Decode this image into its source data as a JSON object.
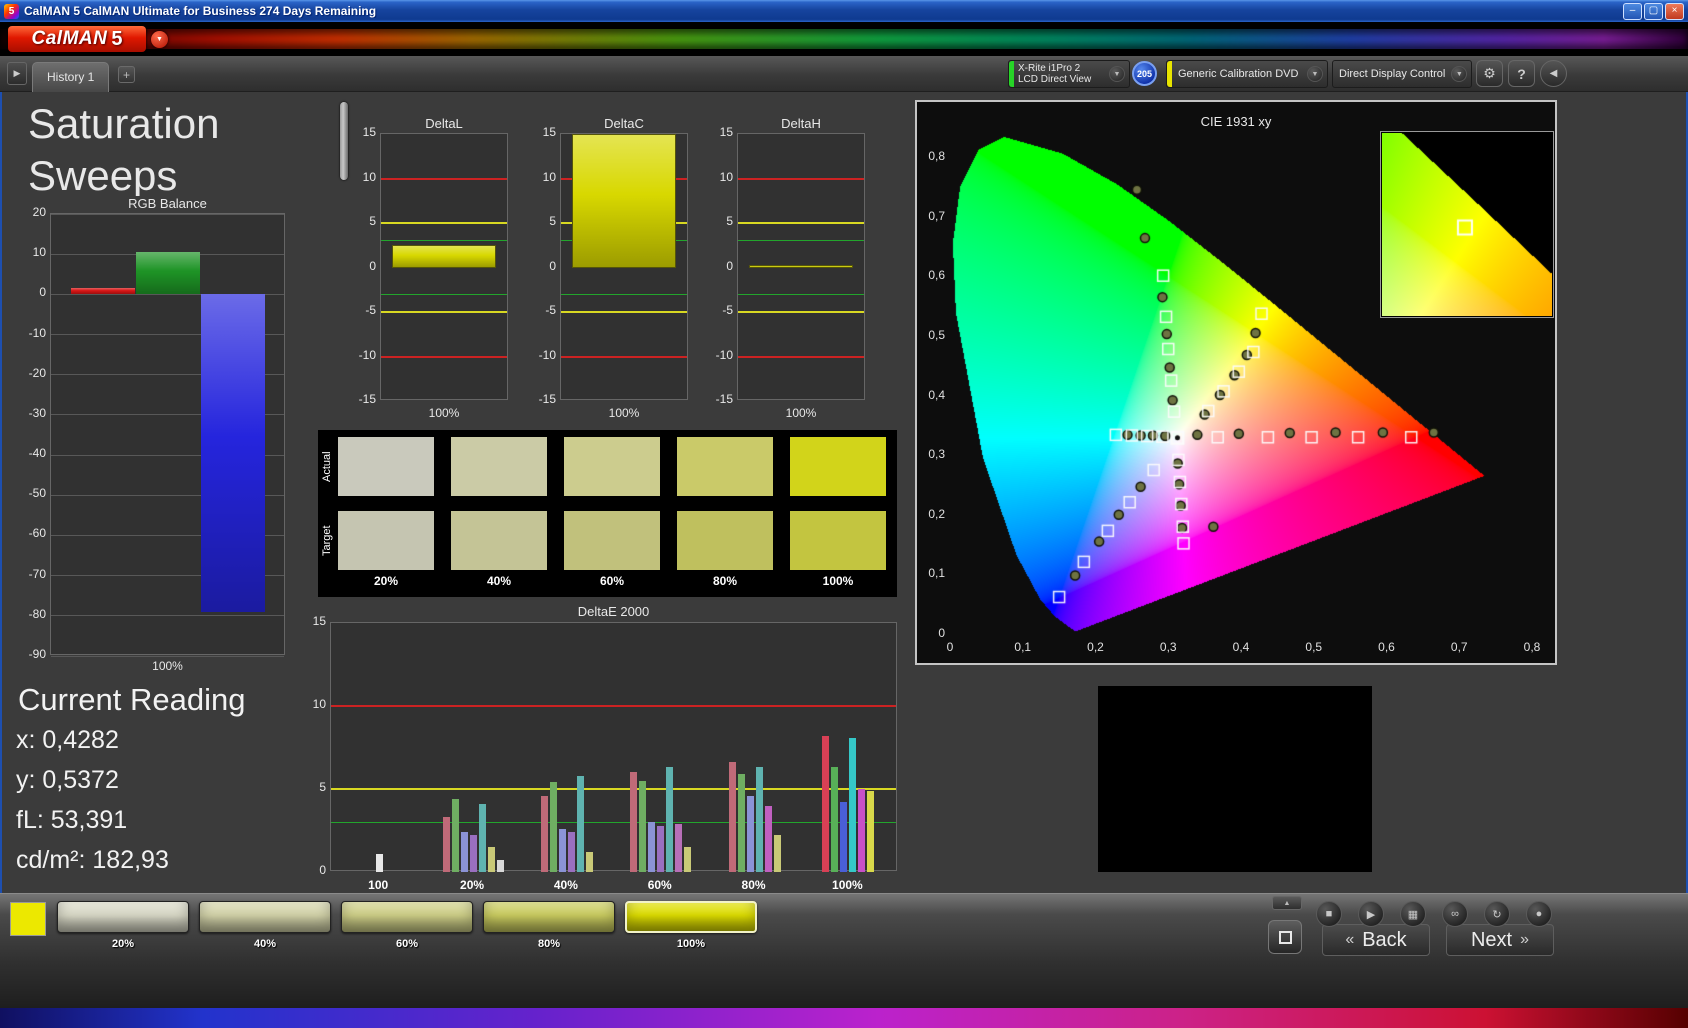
{
  "window": {
    "icon": "5",
    "title": "CalMAN 5 CalMAN Ultimate for Business 274 Days Remaining"
  },
  "icons": {
    "dropdown_arrow": "▼",
    "nav_forward": "▶",
    "nav_back": "◀",
    "gear": "⚙",
    "up_arrow": "▲",
    "window_minimize": "–",
    "window_restore": "▢",
    "window_close": "×"
  },
  "brand": {
    "logo_text": "CalMAN",
    "logo_number": "5"
  },
  "toolbar": {
    "tab": "History 1",
    "add_tab": "+",
    "meter_line1": "X-Rite i1Pro 2",
    "meter_line2": "LCD Direct View",
    "meter_status_color": "#27d427",
    "badge": "205",
    "source_label": "Generic Calibration DVD",
    "source_status_color": "#e8e400",
    "display_label": "Direct Display Control",
    "display_status_color": "#e8e400",
    "help": "?"
  },
  "page": {
    "title_line1": "Saturation",
    "title_line2": "Sweeps"
  },
  "current_reading": {
    "heading": "Current Reading",
    "lines": [
      "x: 0,4282",
      "y: 0,5372",
      "fL: 53,391",
      "cd/m²: 182,93"
    ]
  },
  "swatch_panel": {
    "row_labels": [
      "Actual",
      "Target"
    ],
    "col_labels": [
      "20%",
      "40%",
      "60%",
      "80%",
      "100%"
    ],
    "actual_colors": [
      "#c9c9bc",
      "#cbcba6",
      "#cccc8e",
      "#caca69",
      "#d2d41a"
    ],
    "target_colors": [
      "#c5c5b1",
      "#c4c496",
      "#c1c17c",
      "#bfc05e",
      "#c3c540"
    ]
  },
  "bottom_bar": {
    "mini_swatch_color": "#ece800",
    "swatches": [
      {
        "label": "20%",
        "color": "#dadac8"
      },
      {
        "label": "40%",
        "color": "#d4d4aa"
      },
      {
        "label": "60%",
        "color": "#cfd088"
      },
      {
        "label": "80%",
        "color": "#cbcd60"
      },
      {
        "label": "100%",
        "color": "#e0e000",
        "selected": true
      }
    ],
    "transport": [
      {
        "name": "stop",
        "glyph": "■"
      },
      {
        "name": "play",
        "glyph": "▶"
      },
      {
        "name": "pattern",
        "glyph": "▦"
      },
      {
        "name": "continuous",
        "glyph": "∞"
      },
      {
        "name": "refresh",
        "glyph": "↻"
      },
      {
        "name": "record",
        "glyph": "●"
      }
    ],
    "back_arrow": "«",
    "back_label": "Back",
    "next_label": "Next",
    "next_arrow": "»"
  },
  "chart_data": [
    {
      "id": "rgb_balance",
      "type": "bar",
      "title": "RGB Balance",
      "categories": [
        "Red",
        "Green",
        "Blue"
      ],
      "values": [
        1.5,
        10.5,
        -79
      ],
      "colors": [
        "#d81515",
        "#1e9426",
        "#2525dd"
      ],
      "ylim": [
        -90,
        20
      ],
      "yticks": [
        20,
        10,
        0,
        -10,
        -20,
        -30,
        -40,
        -50,
        -60,
        -70,
        -80,
        -90
      ],
      "xlabel": "100%"
    },
    {
      "id": "deltaL",
      "type": "bar",
      "title": "DeltaL",
      "values": [
        2.5
      ],
      "ylim": [
        -15,
        15
      ],
      "yticks": [
        15,
        10,
        5,
        0,
        -5,
        -10,
        -15
      ],
      "xlabel": "100%",
      "ref_lines": [
        {
          "value": 10,
          "color": "#cc2222",
          "width": 2
        },
        {
          "value": -10,
          "color": "#cc2222",
          "width": 2
        },
        {
          "value": 5,
          "color": "#d8d822",
          "width": 2
        },
        {
          "value": -5,
          "color": "#d8d822",
          "width": 2
        },
        {
          "value": 3,
          "color": "#22a52c",
          "width": 1
        },
        {
          "value": -3,
          "color": "#22a52c",
          "width": 1
        }
      ]
    },
    {
      "id": "deltaC",
      "type": "bar",
      "title": "DeltaC",
      "values": [
        15.2
      ],
      "ylim": [
        -15,
        15
      ],
      "yticks": [
        15,
        10,
        5,
        0,
        -5,
        -10,
        -15
      ],
      "xlabel": "100%",
      "ref_lines": [
        {
          "value": 10,
          "color": "#cc2222",
          "width": 2
        },
        {
          "value": -10,
          "color": "#cc2222",
          "width": 2
        },
        {
          "value": 5,
          "color": "#d8d822",
          "width": 2
        },
        {
          "value": -5,
          "color": "#d8d822",
          "width": 2
        },
        {
          "value": 3,
          "color": "#22a52c",
          "width": 1
        },
        {
          "value": -3,
          "color": "#22a52c",
          "width": 1
        }
      ]
    },
    {
      "id": "deltaH",
      "type": "bar",
      "title": "DeltaH",
      "values": [
        0.3
      ],
      "ylim": [
        -15,
        15
      ],
      "yticks": [
        15,
        10,
        5,
        0,
        -5,
        -10,
        -15
      ],
      "xlabel": "100%",
      "ref_lines": [
        {
          "value": 10,
          "color": "#cc2222",
          "width": 2
        },
        {
          "value": -10,
          "color": "#cc2222",
          "width": 2
        },
        {
          "value": 5,
          "color": "#d8d822",
          "width": 2
        },
        {
          "value": -5,
          "color": "#d8d822",
          "width": 2
        },
        {
          "value": 3,
          "color": "#22a52c",
          "width": 1
        },
        {
          "value": -3,
          "color": "#22a52c",
          "width": 1
        }
      ]
    },
    {
      "id": "deltae2000",
      "type": "bar",
      "title": "DeltaE 2000",
      "ylim": [
        0,
        15
      ],
      "yticks": [
        15,
        10,
        5,
        0
      ],
      "ref_lines": [
        {
          "value": 10,
          "color": "#cc2222",
          "width": 2
        },
        {
          "value": 5,
          "color": "#d8d822",
          "width": 2
        },
        {
          "value": 3,
          "color": "#22a52c",
          "width": 1
        }
      ],
      "groups": [
        {
          "label": "100",
          "bars": [
            {
              "color": "#e8e8e8",
              "value": 1.1
            }
          ]
        },
        {
          "label": "20%",
          "bars": [
            {
              "color": "#c06a78",
              "value": 3.3
            },
            {
              "color": "#6fae62",
              "value": 4.4
            },
            {
              "color": "#8b93d6",
              "value": 2.4
            },
            {
              "color": "#9a6fc0",
              "value": 2.2
            },
            {
              "color": "#5fb3b0",
              "value": 4.1
            },
            {
              "color": "#c9c977",
              "value": 1.5
            },
            {
              "color": "#d8d8d8",
              "value": 0.7
            }
          ]
        },
        {
          "label": "40%",
          "bars": [
            {
              "color": "#c06a78",
              "value": 4.6
            },
            {
              "color": "#6fae62",
              "value": 5.4
            },
            {
              "color": "#8b93d6",
              "value": 2.6
            },
            {
              "color": "#9a6fc0",
              "value": 2.4
            },
            {
              "color": "#5fb3b0",
              "value": 5.8
            },
            {
              "color": "#c9c977",
              "value": 1.2
            }
          ]
        },
        {
          "label": "60%",
          "bars": [
            {
              "color": "#c06a78",
              "value": 6.0
            },
            {
              "color": "#6fae62",
              "value": 5.5
            },
            {
              "color": "#8b93d6",
              "value": 3.0
            },
            {
              "color": "#9a6fc0",
              "value": 2.8
            },
            {
              "color": "#5fb3b0",
              "value": 6.3
            },
            {
              "color": "#b86fb8",
              "value": 2.9
            },
            {
              "color": "#c9c977",
              "value": 1.5
            }
          ]
        },
        {
          "label": "80%",
          "bars": [
            {
              "color": "#c06a78",
              "value": 6.6
            },
            {
              "color": "#6fae62",
              "value": 5.9
            },
            {
              "color": "#8b93d6",
              "value": 4.6
            },
            {
              "color": "#5fb3b0",
              "value": 6.3
            },
            {
              "color": "#c060c0",
              "value": 4.0
            },
            {
              "color": "#c9c977",
              "value": 2.2
            }
          ]
        },
        {
          "label": "100%",
          "bars": [
            {
              "color": "#d84055",
              "value": 8.2
            },
            {
              "color": "#58b058",
              "value": 6.3
            },
            {
              "color": "#4a5fd8",
              "value": 4.2
            },
            {
              "color": "#35c8c8",
              "value": 8.1
            },
            {
              "color": "#c850c8",
              "value": 5.0
            },
            {
              "color": "#d8d84a",
              "value": 4.9
            }
          ]
        }
      ]
    },
    {
      "id": "cie",
      "type": "scatter",
      "title": "CIE 1931 xy",
      "xlim": [
        0,
        0.8
      ],
      "ylim": [
        0,
        0.8
      ],
      "xticks": [
        "0",
        "0,1",
        "0,2",
        "0,3",
        "0,4",
        "0,5",
        "0,6",
        "0,7",
        "0,8"
      ],
      "yticks": [
        "0",
        "0,1",
        "0,2",
        "0,3",
        "0,4",
        "0,5",
        "0,6",
        "0,7",
        "0,8"
      ],
      "white_point": [
        0.3127,
        0.329
      ],
      "current": [
        0.4282,
        0.5372
      ],
      "inset_view": [
        0.355,
        0.505,
        0.455,
        0.625
      ],
      "targets": [
        [
          0.3127,
          0.329
        ],
        [
          0.368,
          0.33
        ],
        [
          0.437,
          0.33
        ],
        [
          0.497,
          0.33
        ],
        [
          0.561,
          0.33
        ],
        [
          0.634,
          0.33
        ],
        [
          0.308,
          0.373
        ],
        [
          0.304,
          0.425
        ],
        [
          0.3,
          0.478
        ],
        [
          0.297,
          0.532
        ],
        [
          0.293,
          0.601
        ],
        [
          0.28,
          0.275
        ],
        [
          0.247,
          0.221
        ],
        [
          0.217,
          0.173
        ],
        [
          0.184,
          0.121
        ],
        [
          0.15,
          0.062
        ],
        [
          0.355,
          0.374
        ],
        [
          0.376,
          0.407
        ],
        [
          0.397,
          0.44
        ],
        [
          0.417,
          0.473
        ],
        [
          0.4282,
          0.5372
        ],
        [
          0.292,
          0.331
        ],
        [
          0.271,
          0.332
        ],
        [
          0.25,
          0.333
        ],
        [
          0.228,
          0.334
        ],
        [
          0.314,
          0.292
        ],
        [
          0.316,
          0.255
        ],
        [
          0.318,
          0.218
        ],
        [
          0.32,
          0.18
        ],
        [
          0.321,
          0.152
        ]
      ],
      "measured": [
        [
          0.34,
          0.334
        ],
        [
          0.397,
          0.336
        ],
        [
          0.467,
          0.337
        ],
        [
          0.53,
          0.338
        ],
        [
          0.595,
          0.338
        ],
        [
          0.665,
          0.338
        ],
        [
          0.306,
          0.392
        ],
        [
          0.302,
          0.447
        ],
        [
          0.298,
          0.503
        ],
        [
          0.292,
          0.565
        ],
        [
          0.268,
          0.664
        ],
        [
          0.257,
          0.745
        ],
        [
          0.262,
          0.247
        ],
        [
          0.232,
          0.2
        ],
        [
          0.205,
          0.155
        ],
        [
          0.172,
          0.098
        ],
        [
          0.35,
          0.368
        ],
        [
          0.371,
          0.401
        ],
        [
          0.391,
          0.434
        ],
        [
          0.408,
          0.468
        ],
        [
          0.42,
          0.505
        ],
        [
          0.296,
          0.332
        ],
        [
          0.279,
          0.333
        ],
        [
          0.262,
          0.333
        ],
        [
          0.244,
          0.334
        ],
        [
          0.313,
          0.286
        ],
        [
          0.315,
          0.251
        ],
        [
          0.317,
          0.215
        ],
        [
          0.319,
          0.178
        ],
        [
          0.362,
          0.18
        ]
      ]
    }
  ]
}
